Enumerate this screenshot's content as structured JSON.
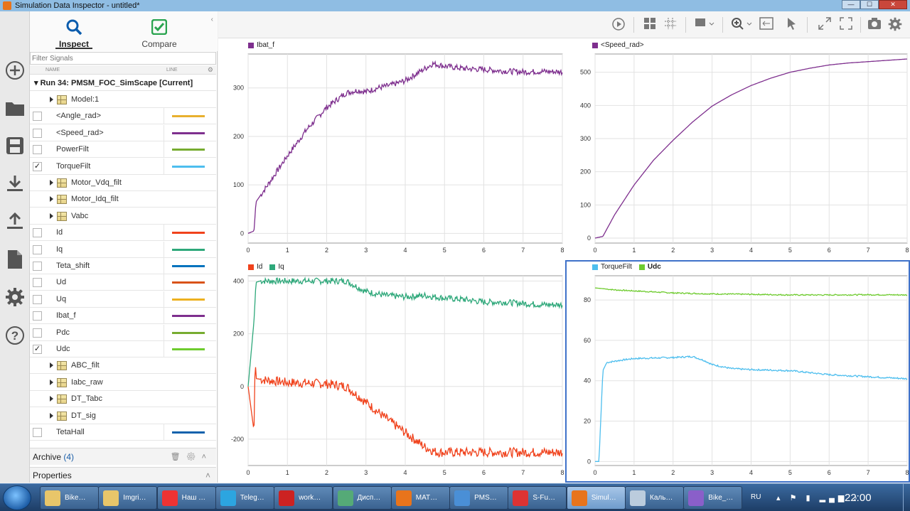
{
  "window": {
    "title": "Simulation Data Inspector - untitled*",
    "buttons": {
      "minimize": "—",
      "maximize": "☐",
      "close": "✕"
    }
  },
  "tabs": [
    {
      "label": "Inspect",
      "icon": "search-icon",
      "active": true
    },
    {
      "label": "Compare",
      "icon": "checkmark-icon",
      "active": false
    }
  ],
  "filter_placeholder": "Filter Signals",
  "columns": {
    "name": "NAME",
    "line": "LINE"
  },
  "run": {
    "label": "Run 34: PMSM_FOC_SimScape [Current]"
  },
  "signals": [
    {
      "type": "group",
      "name": "Model:1"
    },
    {
      "type": "signal",
      "name": "<Angle_rad>",
      "checked": false,
      "color": "#e8b02e"
    },
    {
      "type": "signal",
      "name": "<Speed_rad>",
      "checked": false,
      "color": "#7e2f8e"
    },
    {
      "type": "signal",
      "name": "PowerFilt",
      "checked": false,
      "color": "#77ac30"
    },
    {
      "type": "signal",
      "name": "TorqueFilt",
      "checked": true,
      "color": "#4dbeee"
    },
    {
      "type": "group",
      "name": "Motor_Vdq_filt"
    },
    {
      "type": "group",
      "name": "Motor_Idq_filt"
    },
    {
      "type": "group",
      "name": "Vabc"
    },
    {
      "type": "signal",
      "name": "Id",
      "checked": false,
      "color": "#f0421c"
    },
    {
      "type": "signal",
      "name": "Iq",
      "checked": false,
      "color": "#2ea87a"
    },
    {
      "type": "signal",
      "name": "Teta_shift",
      "checked": false,
      "color": "#0072bd"
    },
    {
      "type": "signal",
      "name": "Ud",
      "checked": false,
      "color": "#d95319"
    },
    {
      "type": "signal",
      "name": "Uq",
      "checked": false,
      "color": "#edb120"
    },
    {
      "type": "signal",
      "name": "Ibat_f",
      "checked": false,
      "color": "#7e2f8e"
    },
    {
      "type": "signal",
      "name": "Pdc",
      "checked": false,
      "color": "#77ac30"
    },
    {
      "type": "signal",
      "name": "Udc",
      "checked": true,
      "color": "#6ecb2e"
    },
    {
      "type": "group",
      "name": "ABC_filt"
    },
    {
      "type": "group",
      "name": "Iabc_raw"
    },
    {
      "type": "group",
      "name": "DT_Tabc"
    },
    {
      "type": "group",
      "name": "DT_sig"
    },
    {
      "type": "signal",
      "name": "TetaHall",
      "checked": false,
      "color": "#0f62ac"
    }
  ],
  "archive": {
    "label": "Archive",
    "count": "(4)"
  },
  "properties_label": "Properties",
  "toolbar_icons": [
    "play-icon",
    "layout-grid-icon",
    "subplot-grid-icon",
    "data-cursor-icon",
    "zoom-icon",
    "fit-icon",
    "pointer-icon",
    "expand-icon",
    "fullscreen-icon",
    "snapshot-icon",
    "settings-icon"
  ],
  "charts": [
    {
      "type": "line",
      "legend": [
        {
          "name": "Ibat_f",
          "color": "#7e2f8e",
          "bold": false
        }
      ],
      "xlim": [
        0,
        8
      ],
      "xticks": [
        0,
        1,
        2,
        3,
        4,
        5,
        6,
        7,
        8
      ],
      "ylim": [
        -20,
        370
      ],
      "yticks": [
        0,
        100,
        200,
        300
      ],
      "series": [
        {
          "name": "Ibat_f",
          "color": "#7e2f8e",
          "noise": 6,
          "x": [
            0,
            0.15,
            0.2,
            0.5,
            1,
            1.5,
            2,
            2.5,
            2.8,
            3,
            3.3,
            3.6,
            4,
            4.3,
            4.7,
            5,
            5.5,
            6,
            6.5,
            7,
            7.5,
            8
          ],
          "y": [
            0,
            5,
            65,
            100,
            160,
            215,
            260,
            290,
            295,
            292,
            300,
            305,
            315,
            330,
            350,
            345,
            340,
            338,
            335,
            333,
            334,
            333
          ]
        }
      ]
    },
    {
      "type": "line",
      "legend": [
        {
          "name": "<Speed_rad>",
          "color": "#7e2f8e",
          "bold": false
        }
      ],
      "xlim": [
        0,
        8
      ],
      "xticks": [
        0,
        1,
        2,
        3,
        4,
        5,
        6,
        7,
        8
      ],
      "ylim": [
        -15,
        555
      ],
      "yticks": [
        0,
        100,
        200,
        300,
        400,
        500
      ],
      "series": [
        {
          "name": "<Speed_rad>",
          "color": "#7e2f8e",
          "noise": 0,
          "x": [
            0,
            0.2,
            0.5,
            1,
            1.5,
            2,
            2.5,
            3,
            3.5,
            4,
            4.5,
            5,
            5.5,
            6,
            6.5,
            7,
            7.5,
            8
          ],
          "y": [
            0,
            5,
            70,
            160,
            235,
            295,
            350,
            398,
            432,
            460,
            482,
            500,
            512,
            522,
            528,
            532,
            536,
            540
          ]
        }
      ]
    },
    {
      "type": "line",
      "legend": [
        {
          "name": "Id",
          "color": "#f0421c",
          "bold": false
        },
        {
          "name": "Iq",
          "color": "#2ea87a",
          "bold": false
        }
      ],
      "xlim": [
        0,
        8
      ],
      "xticks": [
        0,
        1,
        2,
        3,
        4,
        5,
        6,
        7,
        8
      ],
      "ylim": [
        -300,
        420
      ],
      "yticks": [
        -200,
        0,
        200,
        400
      ],
      "series": [
        {
          "name": "Iq",
          "color": "#2ea87a",
          "noise": 12,
          "x": [
            0,
            0.15,
            0.2,
            0.3,
            1,
            2,
            2.5,
            3,
            3.5,
            4,
            4.5,
            5,
            5.5,
            6,
            6.5,
            7,
            7.5,
            8
          ],
          "y": [
            0,
            250,
            395,
            400,
            400,
            400,
            400,
            360,
            345,
            340,
            345,
            335,
            330,
            320,
            320,
            315,
            310,
            310
          ]
        },
        {
          "name": "Id",
          "color": "#f0421c",
          "noise": 18,
          "x": [
            0,
            0.15,
            0.18,
            0.2,
            0.4,
            1,
            2,
            2.5,
            3,
            3.5,
            4,
            4.5,
            4.8,
            5,
            6,
            7,
            8
          ],
          "y": [
            0,
            -170,
            120,
            30,
            25,
            15,
            10,
            0,
            -60,
            -120,
            -175,
            -230,
            -250,
            -250,
            -250,
            -250,
            -250
          ]
        }
      ]
    },
    {
      "type": "line",
      "legend": [
        {
          "name": "TorqueFilt",
          "color": "#4dbeee",
          "bold": false
        },
        {
          "name": "Udc",
          "color": "#6ecb2e",
          "bold": true
        }
      ],
      "xlim": [
        0,
        8
      ],
      "xticks": [
        0,
        1,
        2,
        3,
        4,
        5,
        6,
        7,
        8
      ],
      "ylim": [
        -2,
        92
      ],
      "yticks": [
        0,
        20,
        40,
        60,
        80
      ],
      "series": [
        {
          "name": "Udc",
          "color": "#6ecb2e",
          "noise": 0.3,
          "x": [
            0,
            0.5,
            1,
            2,
            3,
            4,
            5,
            6,
            7,
            8
          ],
          "y": [
            86,
            85,
            84.5,
            83.5,
            83,
            82.8,
            82.5,
            82.5,
            82.6,
            82.5
          ]
        },
        {
          "name": "TorqueFilt",
          "color": "#4dbeee",
          "noise": 0.4,
          "x": [
            0,
            0.1,
            0.2,
            0.3,
            0.6,
            1,
            2,
            2.5,
            2.8,
            3,
            3.5,
            4,
            5,
            6,
            7,
            8
          ],
          "y": [
            0,
            0,
            45,
            49,
            50,
            51,
            51.5,
            52,
            50,
            48,
            46,
            45.5,
            45,
            43,
            42,
            41
          ]
        }
      ]
    }
  ],
  "taskbar": {
    "items": [
      {
        "label": "Bike…",
        "icon": "folder-icon",
        "color": "#e8c66a"
      },
      {
        "label": "Imgri…",
        "icon": "folder-icon",
        "color": "#e8c66a"
      },
      {
        "label": "Наш …",
        "icon": "yandex-browser-icon",
        "color": "#e33"
      },
      {
        "label": "Teleg…",
        "icon": "telegram-icon",
        "color": "#2ca5e0"
      },
      {
        "label": "work…",
        "icon": "matlab-cube-icon",
        "color": "#c22"
      },
      {
        "label": "Дисп…",
        "icon": "task-manager-icon",
        "color": "#5a7"
      },
      {
        "label": "MAT…",
        "icon": "matlab-icon",
        "color": "#e8741c"
      },
      {
        "label": "PMS…",
        "icon": "simulink-icon",
        "color": "#4a8fd6"
      },
      {
        "label": "S-Fu…",
        "icon": "s-function-icon",
        "color": "#d33"
      },
      {
        "label": "Simul…",
        "icon": "sdi-icon",
        "color": "#e8741c",
        "active": true
      },
      {
        "label": "Каль…",
        "icon": "calculator-icon",
        "color": "#bcd"
      },
      {
        "label": "Bike_…",
        "icon": "visual-studio-icon",
        "color": "#8a5fc9"
      }
    ],
    "lang": "RU",
    "clock": "22:00"
  }
}
